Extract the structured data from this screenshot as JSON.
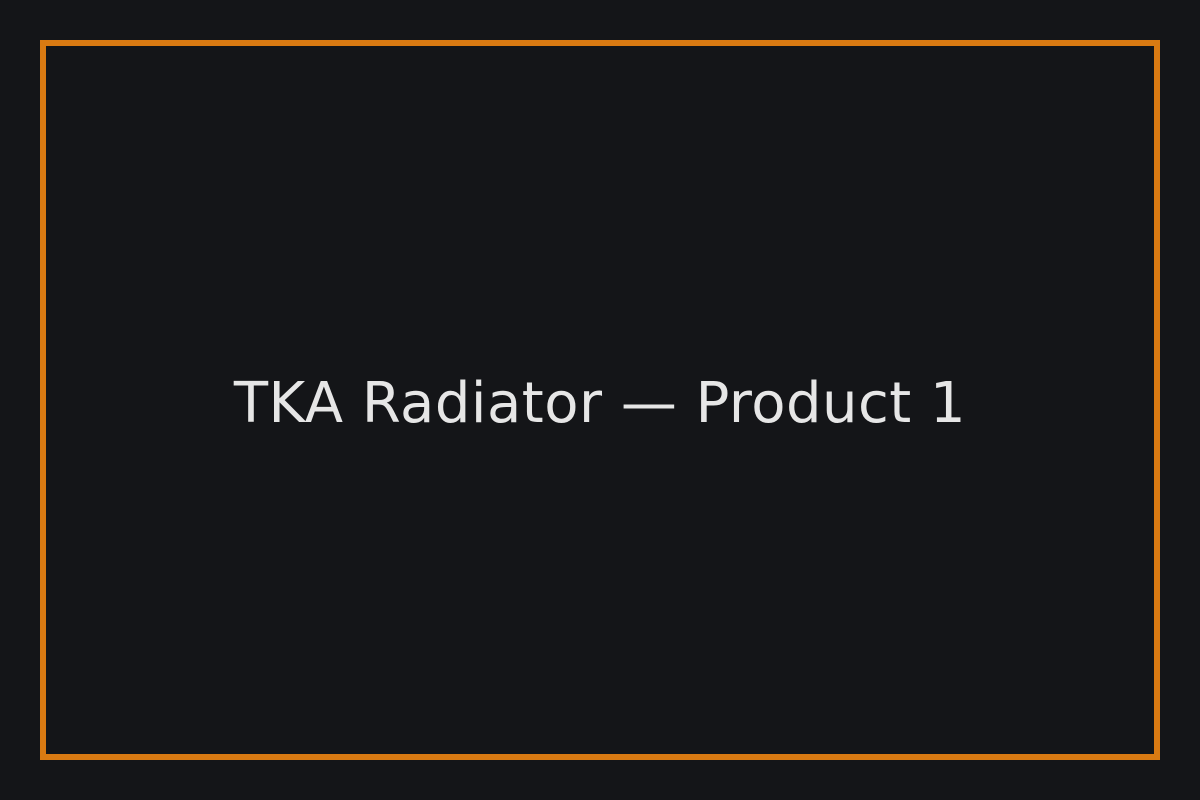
{
  "placeholder": {
    "title": "TKA Radiator — Product 1"
  },
  "colors": {
    "background": "#141518",
    "border": "#d97a12",
    "text": "#e6e6e6"
  }
}
